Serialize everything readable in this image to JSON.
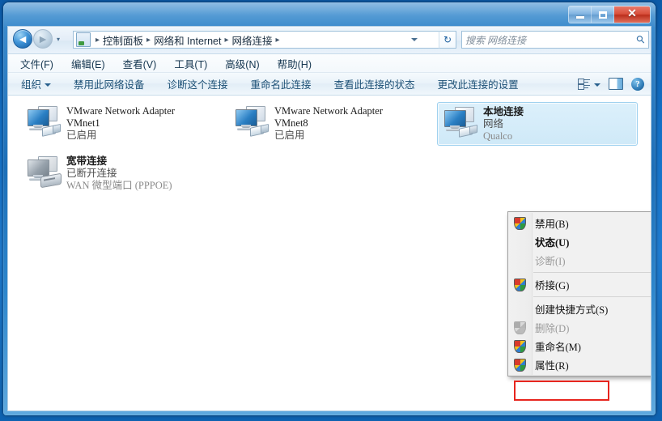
{
  "window": {
    "caption_buttons": {
      "minimize": "minimize-button",
      "maximize": "maximize-button",
      "close": "✕"
    }
  },
  "address_bar": {
    "back_arrow": "◄",
    "forward_arrow": "►",
    "history_caret": "▾",
    "breadcrumb": [
      "控制面板",
      "网络和 Internet",
      "网络连接"
    ],
    "breadcrumb_separator": "▸",
    "refresh_symbol": "↻",
    "search_placeholder": "搜索 网络连接",
    "search_value": ""
  },
  "menubar": {
    "items": [
      "文件(F)",
      "编辑(E)",
      "查看(V)",
      "工具(T)",
      "高级(N)",
      "帮助(H)"
    ]
  },
  "toolbar": {
    "organize_label": "组织",
    "items": [
      "禁用此网络设备",
      "诊断这个连接",
      "重命名此连接",
      "查看此连接的状态",
      "更改此连接的设置"
    ],
    "right_icons": {
      "view_mode": "view-mode-icon",
      "view_mode_caret": "▾",
      "preview_pane": "preview-pane-icon",
      "help": "?"
    }
  },
  "connections": [
    {
      "name": "VMware Network Adapter",
      "name2": "VMnet1",
      "status": "已启用",
      "device": "",
      "selected": false,
      "icon_state": "enabled",
      "icon_kind": "nic"
    },
    {
      "name": "VMware Network Adapter",
      "name2": "VMnet8",
      "status": "已启用",
      "device": "",
      "selected": false,
      "icon_state": "enabled",
      "icon_kind": "nic"
    },
    {
      "name": "本地连接",
      "name2": "",
      "status": "网络",
      "device": "Qualco",
      "selected": true,
      "icon_state": "enabled",
      "icon_kind": "nic"
    },
    {
      "name": "宽带连接",
      "name2": "",
      "status": "已断开连接",
      "device": "WAN 微型端口 (PPPOE)",
      "selected": false,
      "icon_state": "disabled",
      "icon_kind": "modem"
    }
  ],
  "context_menu": {
    "items": [
      {
        "label": "禁用(B)",
        "shield": true,
        "bold": false,
        "disabled": false,
        "separator_after": false
      },
      {
        "label": "状态(U)",
        "shield": false,
        "bold": true,
        "disabled": false,
        "separator_after": false
      },
      {
        "label": "诊断(I)",
        "shield": false,
        "bold": false,
        "disabled": true,
        "separator_after": true
      },
      {
        "label": "桥接(G)",
        "shield": true,
        "bold": false,
        "disabled": false,
        "separator_after": true
      },
      {
        "label": "创建快捷方式(S)",
        "shield": false,
        "bold": false,
        "disabled": false,
        "separator_after": false
      },
      {
        "label": "删除(D)",
        "shield": true,
        "bold": false,
        "disabled": true,
        "separator_after": false
      },
      {
        "label": "重命名(M)",
        "shield": true,
        "bold": false,
        "disabled": false,
        "separator_after": false
      },
      {
        "label": "属性(R)",
        "shield": true,
        "bold": false,
        "disabled": false,
        "separator_after": false
      }
    ],
    "highlight_item": "属性(R)",
    "highlight_color": "#e7251e"
  },
  "colors": {
    "desktop": "#1a6fc4",
    "selection_fill": "#cfe9f8",
    "selection_border": "#9fd1ef",
    "highlight_red": "#e7251e"
  }
}
